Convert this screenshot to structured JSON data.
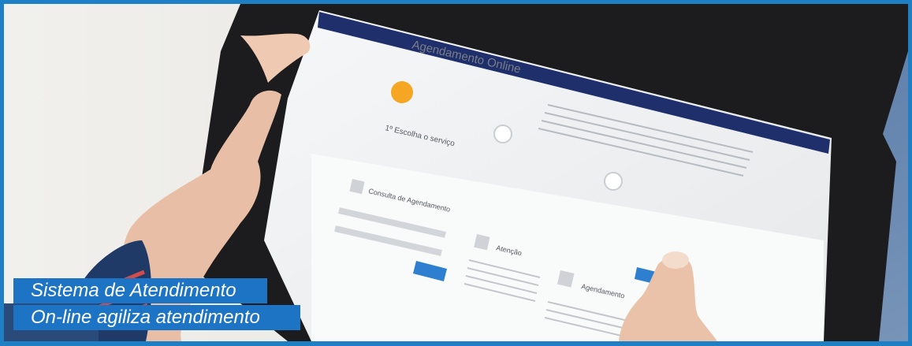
{
  "photo": {
    "subject": "tablet-with-scheduling-site",
    "screen": {
      "page_title": "Agendamento Online",
      "step_label": "1º Escolha o serviço",
      "panel_left_title": "Consulta de Agendamento",
      "panel_mid_title": "Atenção",
      "panel_right_title": "Agendamento"
    }
  },
  "caption": {
    "line1": "Sistema de Atendimento",
    "line2": "On-line agiliza atendimento"
  },
  "colors": {
    "frame": "#1f7fc4",
    "caption_bg": "#1d74c4",
    "caption_text": "#ffffff",
    "accent_orange": "#f5a623",
    "site_navy": "#1f2f6b",
    "button_blue": "#2f7fd0"
  }
}
